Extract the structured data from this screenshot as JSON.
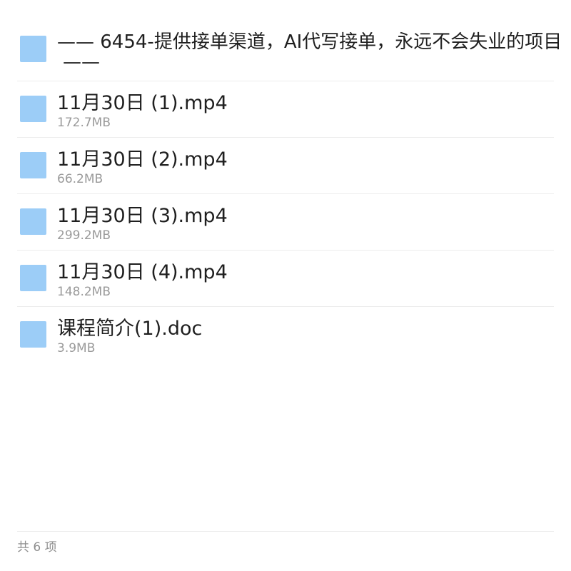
{
  "folder": {
    "title_line1": "—— 6454-提供接单渠道，AI代写接单，永远不会失业的项目",
    "title_line2": "——"
  },
  "files": [
    {
      "name": "11月30日 (1).mp4",
      "size": "172.7MB",
      "icon": "file-icon"
    },
    {
      "name": "11月30日 (2).mp4",
      "size": "66.2MB",
      "icon": "file-icon"
    },
    {
      "name": "11月30日 (3).mp4",
      "size": "299.2MB",
      "icon": "file-icon"
    },
    {
      "name": "11月30日 (4).mp4",
      "size": "148.2MB",
      "icon": "file-icon"
    },
    {
      "name": "课程简介(1).doc",
      "size": "3.9MB",
      "icon": "file-icon"
    }
  ],
  "footer": {
    "count_text": "共 6 项"
  },
  "colors": {
    "icon_fill": "#9ccdf7",
    "divider": "#ececec",
    "secondary_text": "#9a9a9a"
  }
}
